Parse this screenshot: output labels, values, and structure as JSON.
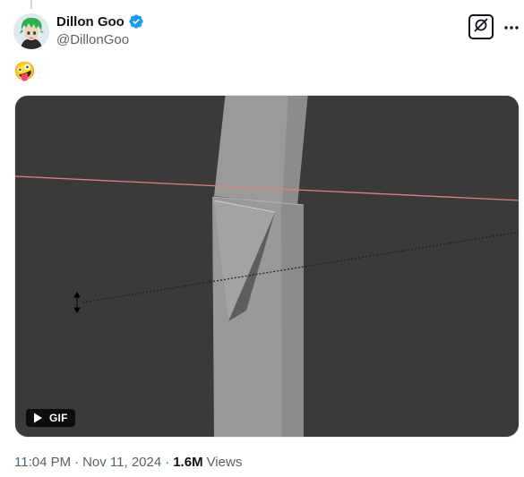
{
  "author": {
    "display_name": "Dillon Goo",
    "handle": "@DillonGoo",
    "verified": true,
    "verified_icon": "verified-badge-icon",
    "avatar_icon": "avatar"
  },
  "header": {
    "grok_icon": "grok-icon",
    "more_icon": "more-options-icon"
  },
  "tweet": {
    "text": "🤪"
  },
  "media": {
    "type": "gif",
    "badge_label": "GIF",
    "play_icon": "play-icon"
  },
  "meta": {
    "time": "11:04 PM",
    "separator": "·",
    "date": "Nov 11, 2024",
    "views_count": "1.6M",
    "views_label": "Views"
  },
  "colors": {
    "text_primary": "#0f1419",
    "text_secondary": "#536471",
    "verified_blue": "#1d9bf0",
    "media_background": "#3a3a3a"
  }
}
